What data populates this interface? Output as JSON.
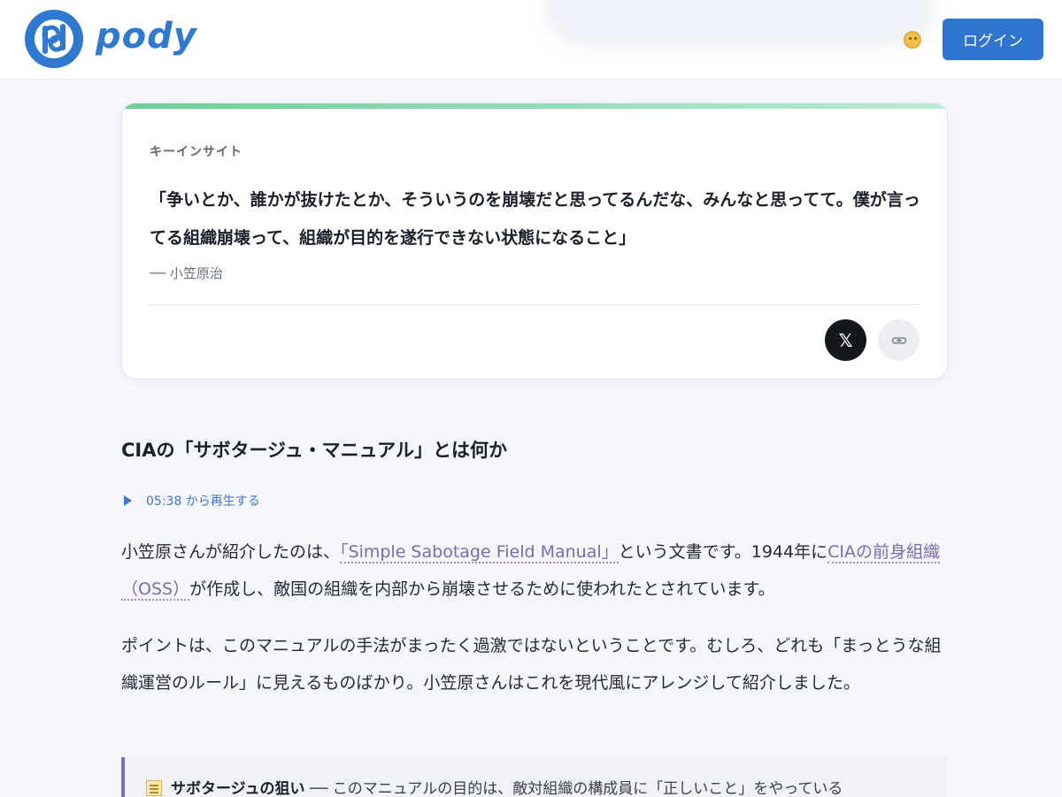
{
  "header": {
    "logo_text": "pody",
    "login_label": "ログイン"
  },
  "insight": {
    "label": "キーインサイト",
    "quote": "「争いとか、誰かが抜けたとか、そういうのを崩壊だと思ってるんだな、みんなと思ってて。僕が言ってる組織崩壊って、組織が目的を遂行できない状態になること」",
    "author": "── 小笠原治",
    "share_x_label": "𝕏"
  },
  "article": {
    "section_title": "CIAの「サボタージュ・マニュアル」とは何か",
    "play_label": "05:38 から再生する",
    "para1": {
      "t1": "小笠原さんが紹介したのは、",
      "link1": "「Simple Sabotage Field Manual」",
      "t2": "という文書です。1944年に",
      "link2": "CIAの前身組織（OSS）",
      "t3": "が作成し、敵国の組織を内部から崩壊させるために使われたとされています。"
    },
    "para2": "ポイントは、このマニュアルの手法がまったく過激ではないということです。むしろ、どれも「まっとうな組織運営のルール」に見えるものばかり。小笠原さんはこれを現代風にアレンジして紹介しました。",
    "callout": {
      "title": "サボタージュの狙い",
      "text": " ── このマニュアルの目的は、敵対組織の構成員に「正しいこと」をやっている"
    }
  },
  "colors": {
    "brand": "#2f79d1",
    "link": "#7a6bb5",
    "accent_green": "#6ccf98"
  }
}
